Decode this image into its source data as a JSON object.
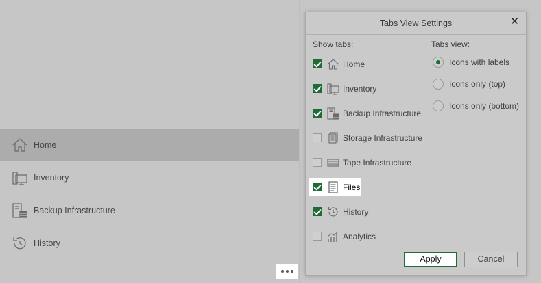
{
  "nav": {
    "items": [
      {
        "label": "Home",
        "icon": "home-icon",
        "selected": true
      },
      {
        "label": "Inventory",
        "icon": "inventory-icon",
        "selected": false
      },
      {
        "label": "Backup Infrastructure",
        "icon": "backup-infrastructure-icon",
        "selected": false
      },
      {
        "label": "History",
        "icon": "history-icon",
        "selected": false
      }
    ],
    "more_icon": "more-dots-icon"
  },
  "dialog": {
    "title": "Tabs View Settings",
    "close_icon": "close-icon",
    "show_tabs_label": "Show tabs:",
    "tabs_view_label": "Tabs view:",
    "tabs": [
      {
        "label": "Home",
        "checked": true,
        "icon": "home-icon"
      },
      {
        "label": "Inventory",
        "checked": true,
        "icon": "inventory-icon"
      },
      {
        "label": "Backup Infrastructure",
        "checked": true,
        "icon": "backup-infrastructure-icon"
      },
      {
        "label": "Storage Infrastructure",
        "checked": false,
        "icon": "storage-infrastructure-icon"
      },
      {
        "label": "Tape Infrastructure",
        "checked": false,
        "icon": "tape-infrastructure-icon"
      },
      {
        "label": "Files",
        "checked": true,
        "icon": "files-icon",
        "highlighted": true
      },
      {
        "label": "History",
        "checked": true,
        "icon": "history-icon"
      },
      {
        "label": "Analytics",
        "checked": false,
        "icon": "analytics-icon"
      }
    ],
    "view_options": [
      {
        "label": "Icons with labels",
        "selected": true
      },
      {
        "label": "Icons only (top)",
        "selected": false
      },
      {
        "label": "Icons only (bottom)",
        "selected": false
      }
    ],
    "apply_label": "Apply",
    "cancel_label": "Cancel"
  },
  "colors": {
    "accent": "#1e6b36",
    "background": "#c6c6c6",
    "selected_row": "#acacac"
  }
}
